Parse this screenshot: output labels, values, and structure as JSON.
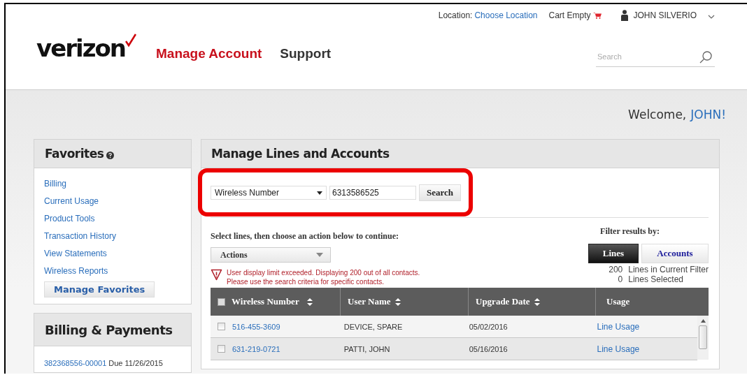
{
  "top_bar": {
    "location_label": "Location:",
    "location_link": "Choose Location",
    "cart": "Cart Empty",
    "user": "JOHN SILVERIO"
  },
  "logo": "verizon",
  "nav": [
    {
      "label": "Manage Account",
      "selected": true
    },
    {
      "label": "Support",
      "selected": false
    }
  ],
  "search": {
    "placeholder": "Search"
  },
  "welcome": {
    "greeting": "Welcome,",
    "name": "JOHN!"
  },
  "favorites": {
    "title": "Favorites",
    "links": [
      "Billing",
      "Current Usage",
      "Product Tools",
      "Transaction History",
      "View Statements",
      "Wireless Reports"
    ],
    "button": "Manage Favorites"
  },
  "billing": {
    "title": "Billing & Payments",
    "account": "382368556-00001",
    "due": "Due 11/26/2015"
  },
  "main": {
    "title": "Manage Lines and Accounts",
    "search_highlighted": true,
    "search_by": "Wireless Number",
    "search_value": "6313586525",
    "search_button": "Search",
    "instruction": "Select lines, then choose an action below to continue:",
    "actions": "Actions",
    "filter_label": "Filter results by:",
    "filters": [
      {
        "label": "Lines",
        "selected": true
      },
      {
        "label": "Accounts",
        "selected": false
      }
    ],
    "counts": [
      {
        "number": "200",
        "label": "Lines in Current Filter"
      },
      {
        "number": "0",
        "label": "Lines Selected"
      }
    ],
    "warning": [
      "User display limit exceeded. Displaying 200 out of all contacts.",
      "Please use the search criteria for specific contacts."
    ],
    "table": {
      "select_all": false,
      "columns": [
        {
          "label": "Wireless Number",
          "sortable": true
        },
        {
          "label": "User Name",
          "sortable": true
        },
        {
          "label": "Upgrade Date",
          "sortable": true
        },
        {
          "label": "Usage",
          "sortable": false
        }
      ],
      "rows": [
        {
          "checked": false,
          "number": "516-455-3609",
          "user": "DEVICE, SPARE",
          "upgrade": "05/02/2016",
          "usage": "Line Usage"
        },
        {
          "checked": false,
          "number": "631-219-0721",
          "user": "PATTI, JOHN",
          "upgrade": "05/16/2016",
          "usage": "Line Usage"
        }
      ]
    }
  }
}
